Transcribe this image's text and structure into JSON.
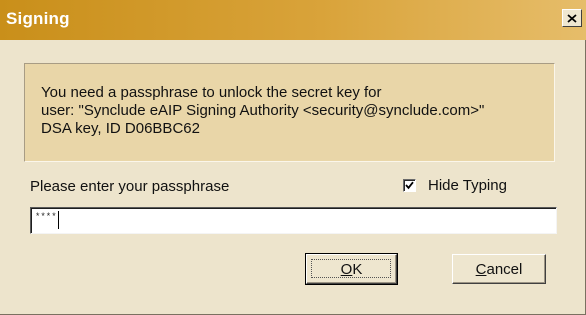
{
  "window": {
    "title": "Signing"
  },
  "info": {
    "line1": "You need a passphrase to unlock the secret key for",
    "line2": "user: \"Synclude eAIP Signing Authority <security@synclude.com>\"",
    "line3": "DSA key, ID D06BBC62"
  },
  "form": {
    "prompt_label": "Please enter your passphrase",
    "hide_typing_label": "Hide Typing",
    "hide_typing_checked": true,
    "passphrase_value": "****"
  },
  "buttons": {
    "ok_mnemonic": "O",
    "ok_rest": "K",
    "cancel_mnemonic": "C",
    "cancel_rest": "ancel"
  },
  "icons": {
    "close": "close-icon",
    "check": "check-icon"
  },
  "colors": {
    "titlebar": "#c98f1a",
    "dialog_background": "#ede4cc",
    "info_background": "#e9d6a8"
  }
}
